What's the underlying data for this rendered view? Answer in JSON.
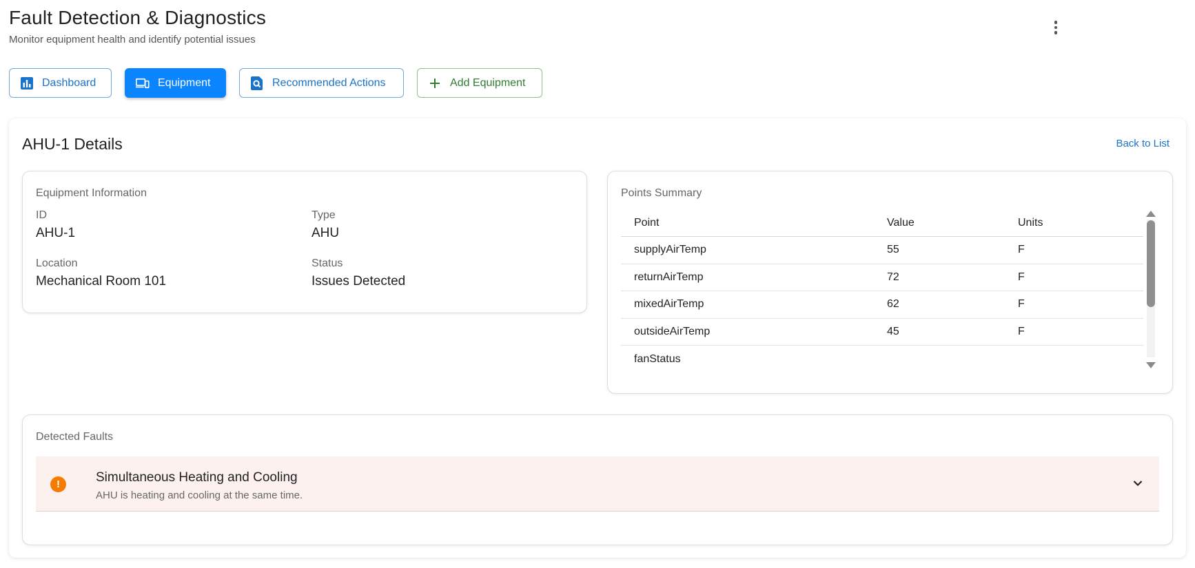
{
  "header": {
    "title": "Fault Detection & Diagnostics",
    "subtitle": "Monitor equipment health and identify potential issues"
  },
  "toolbar": {
    "dashboard_label": "Dashboard",
    "equipment_label": "Equipment",
    "actions_label": "Recommended Actions",
    "add_label": "Add Equipment"
  },
  "details": {
    "title": "AHU-1 Details",
    "back_label": "Back to List"
  },
  "equipment_info": {
    "title": "Equipment Information",
    "id_label": "ID",
    "id_value": "AHU-1",
    "type_label": "Type",
    "type_value": "AHU",
    "location_label": "Location",
    "location_value": "Mechanical Room 101",
    "status_label": "Status",
    "status_value": "Issues Detected"
  },
  "points_summary": {
    "title": "Points Summary",
    "columns": [
      "Point",
      "Value",
      "Units"
    ],
    "rows": [
      [
        "supplyAirTemp",
        "55",
        "F"
      ],
      [
        "returnAirTemp",
        "72",
        "F"
      ],
      [
        "mixedAirTemp",
        "62",
        "F"
      ],
      [
        "outsideAirTemp",
        "45",
        "F"
      ],
      [
        "fanStatus",
        "",
        ""
      ]
    ]
  },
  "faults": {
    "title": "Detected Faults",
    "items": [
      {
        "title": "Simultaneous Heating and Cooling",
        "description": "AHU is heating and cooling at the same time."
      }
    ]
  },
  "colors": {
    "primary": "#0a84ff",
    "link": "#1a73c8",
    "success": "#2e7d32",
    "warning": "#f57c00",
    "fault_bg": "#fdf1f0"
  },
  "icons": {
    "dashboard": "bar-chart-icon",
    "equipment": "devices-icon",
    "actions": "search-document-icon",
    "add": "plus-icon",
    "more": "more-vertical-icon",
    "fault": "warning-icon",
    "expand": "chevron-down-icon"
  }
}
